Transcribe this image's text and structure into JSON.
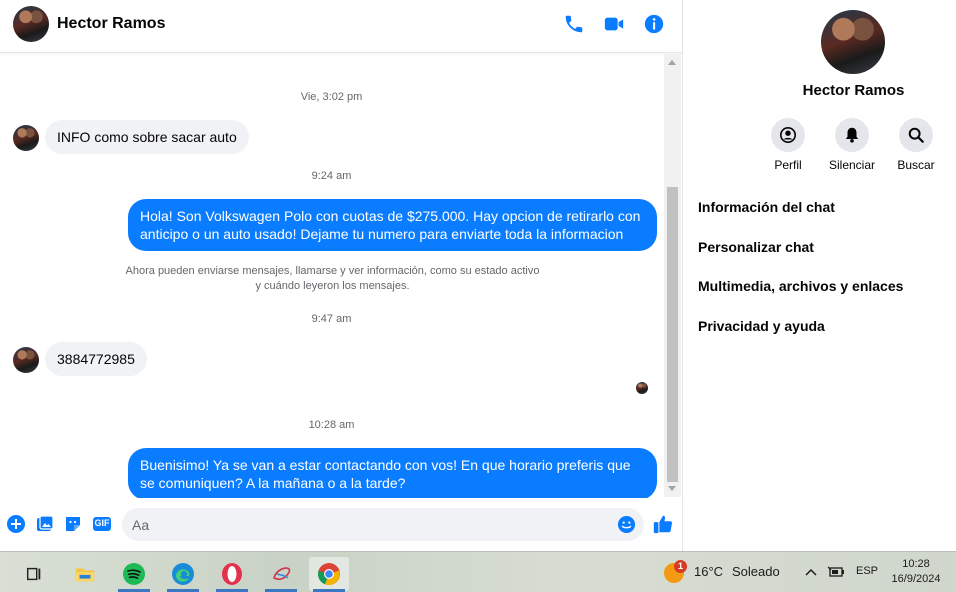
{
  "header": {
    "contact_name": "Hector Ramos",
    "call_icon": "phone-icon",
    "video_icon": "video-camera-icon",
    "info_icon": "info-icon",
    "accent_color": "#0a7cff"
  },
  "messages": {
    "ts1": "Vie, 3:02 pm",
    "in1": "INFO como sobre sacar auto",
    "ts2": "9:24 am",
    "out1": "Hola! Son Volkswagen Polo con cuotas de $275.000. Hay opcion de retirarlo con anticipo o un auto usado! Dejame tu numero para enviarte toda la informacion",
    "system_line1": "Ahora pueden enviarse mensajes, llamarse y ver información, como su estado activo",
    "system_line2": "y cuándo leyeron los mensajes.",
    "ts3": "9:47 am",
    "in2": "3884772985",
    "ts4": "10:28 am",
    "out2": "Buenisimo! Ya se van a estar contactando con vos! En que horario preferis que se comuniquen? A la mañana o a la tarde?"
  },
  "composer": {
    "placeholder": "Aa",
    "icons": [
      "plus-icon",
      "image-icon",
      "sticker-icon",
      "gif-icon",
      "emoji-icon",
      "thumbs-up-icon"
    ],
    "gif_label": "GIF"
  },
  "info_panel": {
    "name": "Hector Ramos",
    "actions": [
      {
        "label": "Perfil",
        "icon": "profile-icon"
      },
      {
        "label": "Silenciar",
        "icon": "bell-icon"
      },
      {
        "label": "Buscar",
        "icon": "search-icon"
      }
    ],
    "menu": [
      "Información del chat",
      "Personalizar chat",
      "Multimedia, archivos y enlaces",
      "Privacidad y ayuda"
    ]
  },
  "taskbar": {
    "apps": [
      "task-view-icon",
      "file-explorer-icon",
      "spotify-icon",
      "edge-icon",
      "opera-icon",
      "app-icon",
      "chrome-icon"
    ],
    "weather_badge": "1",
    "temperature": "16°C",
    "weather": "Soleado",
    "language": "ESP",
    "time": "10:28",
    "date": "16/9/2024"
  }
}
